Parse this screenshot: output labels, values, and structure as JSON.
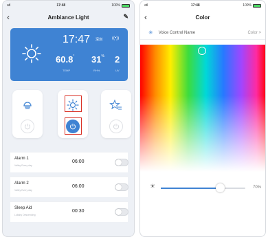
{
  "left": {
    "status": {
      "carrier": "atl",
      "time": "17:48",
      "battery_text": "100%"
    },
    "title": "Ambiance Light",
    "back_icon": "chevron-left-icon",
    "edit_icon": "pencil-icon",
    "weather": {
      "time": "17:47",
      "city": "深圳",
      "signal": "((•))",
      "temp": "60.8",
      "temp_unit": "°",
      "rh": "31",
      "rh_unit": "%",
      "uv": "2",
      "temp_label": "TEMP",
      "rh_label": "RH%",
      "uv_label": "UV",
      "icon": "sun-icon"
    },
    "modes": [
      {
        "icon": "lamp-icon",
        "power": "off"
      },
      {
        "icon": "sun-icon",
        "power": "on",
        "highlighted": true
      },
      {
        "icon": "star-icon",
        "power": "off"
      }
    ],
    "rows": [
      {
        "name": "Alarm 1",
        "sub": "Valley Every day",
        "time": "06:00",
        "on": false
      },
      {
        "name": "Alarm 2",
        "sub": "Valley Every day",
        "time": "06:00",
        "on": false
      },
      {
        "name": "Sleep Aid",
        "sub": "Lullaby Descending",
        "time": "00:30",
        "on": false
      }
    ]
  },
  "right": {
    "status": {
      "carrier": "atl",
      "time": "17:48",
      "battery_text": "100%"
    },
    "title": "Color",
    "back_icon": "chevron-left-icon",
    "voice": {
      "label": "Voice Control Name",
      "value": "Color",
      "chevron": ">"
    },
    "brightness": {
      "value": 70,
      "label": "70%"
    }
  },
  "colors": {
    "accent": "#3f83d3",
    "highlight": "#d93025"
  }
}
